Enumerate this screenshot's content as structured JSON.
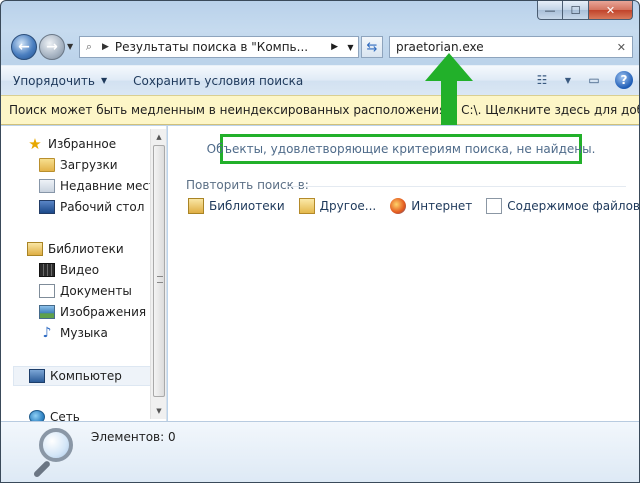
{
  "window": {
    "min_glyph": "—",
    "max_glyph": "☐",
    "close_glyph": "✕"
  },
  "nav": {
    "address_text": "Результаты поиска в \"Компь...",
    "search_value": "praetorian.exe"
  },
  "toolbar": {
    "organize_label": "Упорядочить",
    "save_search_label": "Сохранить условия поиска",
    "help_label": "?"
  },
  "infobar": {
    "text": "Поиск может быть медленным в неиндексированных расположениях: C:\\. Щелкните здесь для добавле..."
  },
  "navpane": {
    "favorites": "Избранное",
    "downloads": "Загрузки",
    "recent": "Недавние места",
    "desktop": "Рабочий стол",
    "libraries": "Библиотеки",
    "video": "Видео",
    "documents": "Документы",
    "pictures": "Изображения",
    "music": "Музыка",
    "computer": "Компьютер",
    "network": "Сеть"
  },
  "content": {
    "no_results": "Объекты, удовлетворяющие критериям поиска, не найдены.",
    "retry_label": "Повторить поиск в:",
    "options": {
      "libraries": "Библиотеки",
      "other": "Другое...",
      "internet": "Интернет",
      "file_contents": "Содержимое файлов"
    }
  },
  "details": {
    "count_text": "Элементов: 0"
  },
  "colors": {
    "annotation": "#22b02a",
    "infobar_bg": "#fdf6c7"
  },
  "icons": [
    "back-arrow-icon",
    "forward-arrow-icon",
    "search-results-icon",
    "refresh-icon",
    "clear-search-icon",
    "view-options-icon",
    "preview-pane-icon",
    "help-icon",
    "star-icon",
    "folder-icon",
    "magnifier-icon",
    "green-arrow-annotation"
  ]
}
